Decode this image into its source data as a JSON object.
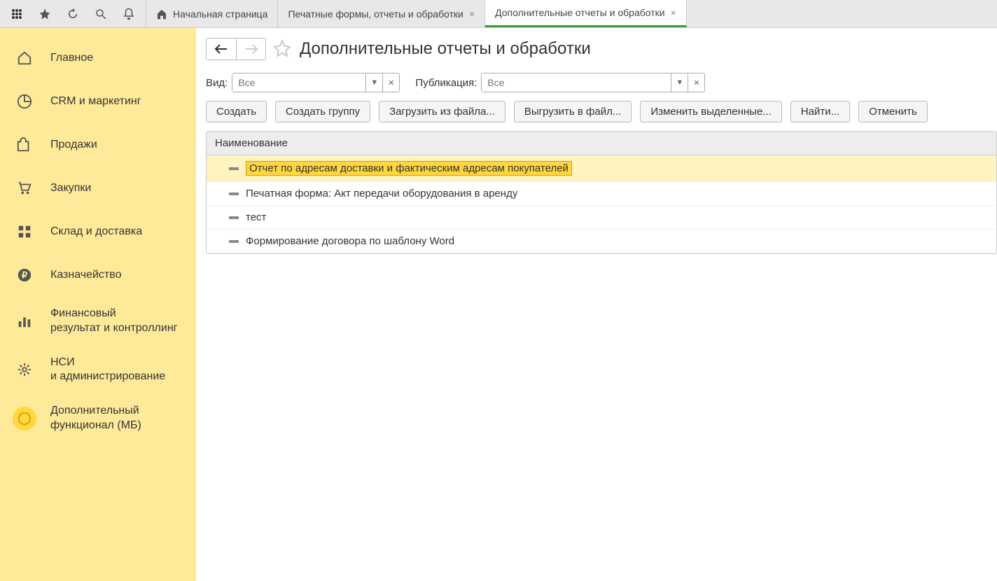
{
  "toolbar": {
    "icons": [
      "apps",
      "star",
      "history",
      "search",
      "bell"
    ]
  },
  "tabs": [
    {
      "label": "Начальная страница",
      "closable": false,
      "home": true,
      "active": false
    },
    {
      "label": "Печатные формы, отчеты и обработки",
      "closable": true,
      "home": false,
      "active": false
    },
    {
      "label": "Дополнительные отчеты и обработки",
      "closable": true,
      "home": false,
      "active": true
    }
  ],
  "sidebar": {
    "items": [
      {
        "icon": "home",
        "label": "Главное"
      },
      {
        "icon": "pie",
        "label": "CRM и маркетинг"
      },
      {
        "icon": "bag",
        "label": "Продажи"
      },
      {
        "icon": "cart",
        "label": "Закупки"
      },
      {
        "icon": "grid",
        "label": "Склад и доставка"
      },
      {
        "icon": "ruble",
        "label": "Казначейство"
      },
      {
        "icon": "chart",
        "label": "Финансовый\nрезультат и контроллинг"
      },
      {
        "icon": "gear",
        "label": "НСИ\nи администрирование"
      },
      {
        "icon": "circle",
        "label": "Дополнительный\nфункционал (МБ)",
        "active": true
      }
    ]
  },
  "page": {
    "title": "Дополнительные отчеты и обработки",
    "filters": {
      "kind_label": "Вид:",
      "kind_placeholder": "Все",
      "pub_label": "Публикация:",
      "pub_placeholder": "Все"
    },
    "buttons": {
      "create": "Создать",
      "create_group": "Создать группу",
      "load_file": "Загрузить из файла...",
      "save_file": "Выгрузить в файл...",
      "edit_selected": "Изменить выделенные...",
      "find": "Найти...",
      "cancel": "Отменить"
    },
    "list": {
      "header": "Наименование",
      "rows": [
        {
          "text": "Отчет по адресам доставки и фактическим адресам покупателей",
          "selected": true
        },
        {
          "text": "Печатная форма: Акт передачи оборудования в аренду",
          "selected": false
        },
        {
          "text": "тест",
          "selected": false
        },
        {
          "text": "Формирование договора по шаблону Word",
          "selected": false
        }
      ]
    }
  }
}
